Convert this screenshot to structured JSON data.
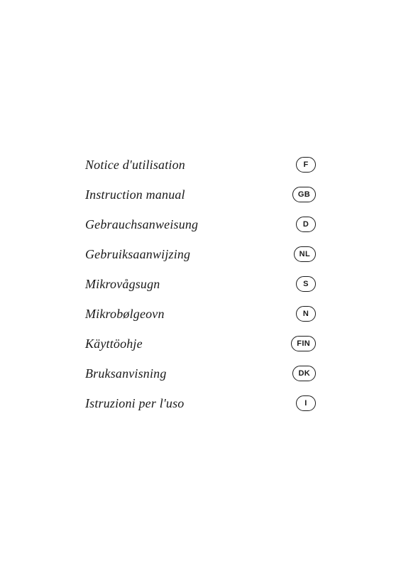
{
  "manuals": {
    "items": [
      {
        "label": "Notice d'utilisation",
        "badge": "F"
      },
      {
        "label": "Instruction manual",
        "badge": "GB"
      },
      {
        "label": "Gebrauchsanweisung",
        "badge": "D"
      },
      {
        "label": "Gebruiksaanwijzing",
        "badge": "NL"
      },
      {
        "label": "Mikrovågsugn",
        "badge": "S"
      },
      {
        "label": "Mikrobølgeovn",
        "badge": "N"
      },
      {
        "label": "Käyttöohje",
        "badge": "FIN"
      },
      {
        "label": "Bruksanvisning",
        "badge": "DK"
      },
      {
        "label": "Istruzioni per l'uso",
        "badge": "I"
      }
    ]
  }
}
